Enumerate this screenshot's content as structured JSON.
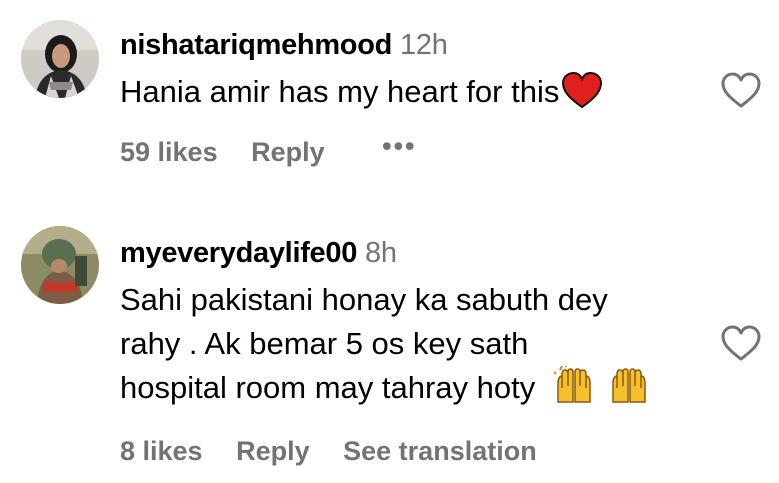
{
  "comments": [
    {
      "username": "nishatariqmehmood",
      "time": "12h",
      "text": "Hania amir has my heart for this",
      "emoji": "red-heart",
      "likes": "59 likes",
      "reply": "Reply",
      "more": "•••"
    },
    {
      "username": "myeverydaylife00",
      "time": "8h",
      "text_lines": [
        "Sahi pakistani honay ka sabuth dey",
        "rahy . Ak bemar 5 os key sath",
        "hospital room may tahray hoty"
      ],
      "emoji": "raising-hands",
      "likes": "8 likes",
      "reply": "Reply",
      "translation": "See translation"
    }
  ],
  "colors": {
    "secondary_text": "#737373",
    "heart_red": "#e0201e",
    "emoji_yellow": "#f6c02d"
  }
}
